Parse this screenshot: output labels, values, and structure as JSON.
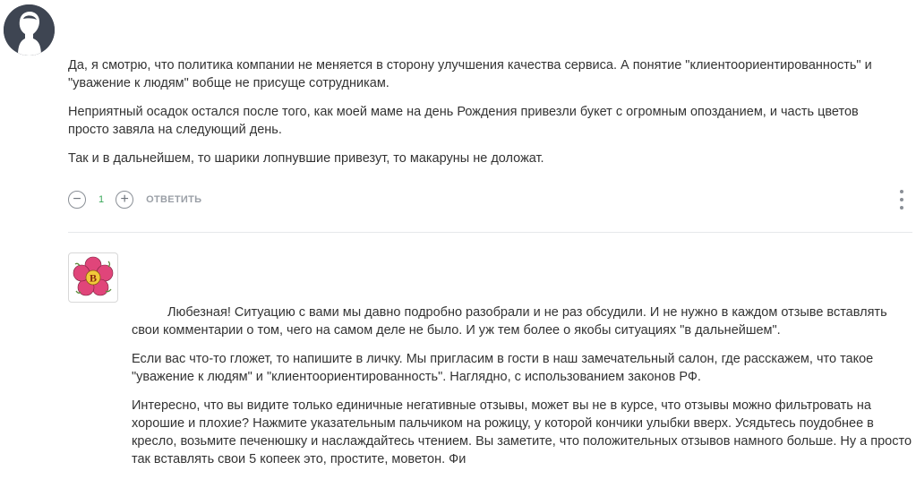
{
  "comment": {
    "paragraphs": [
      "Да, я смотрю, что политика компании не меняется в сторону улучшения качества сервиса. А понятие \"клиентоориентированность\" и \"уважение к людям\" вобще не присуще сотрудникам.",
      "Неприятный осадок остался после того, как моей маме на день Рождения привезли букет с огромным опозданием, и часть цветов просто завяла на следующий день.",
      "Так и в дальнейшем, то шарики лопнувшие привезут, то макаруны не доложат."
    ],
    "rating_count": "1",
    "reply_label": "ОТВЕТИТЬ",
    "minus_symbol": "−",
    "plus_symbol": "+"
  },
  "reply": {
    "paragraphs": [
      "Любезная! Ситуацию с вами мы давно подробно разобрали и не раз обсудили. И не нужно в каждом отзыве вставлять свои комментарии о том, чего на самом деле не было. И уж тем более о якобы ситуациях \"в дальнейшем\".",
      "Если вас что-то гложет, то напишите в личку. Мы пригласим в гости в наш замечательный салон, где расскажем, что такое \"уважение к людям\" и \"клиентоориентированность\". Наглядно, с использованием законов РФ.",
      "Интересно, что вы видите только единичные негативные отзывы, может вы не в курсе, что отзывы можно фильтровать на хорошие и плохие? Нажмите указательным пальчиком на рожицу, у которой кончики улыбки вверх. Усядьтесь поудобнее в кресло, возьмите печенюшку и наслаждайтесь чтением. Вы заметите, что положительных отзывов намного больше. Ну а просто так вставлять свои 5 копеек это, простите, моветон. Фи"
    ],
    "brand_letter": "B"
  },
  "colors": {
    "count_green": "#3aa85a",
    "flower_pink": "#e0457a"
  }
}
